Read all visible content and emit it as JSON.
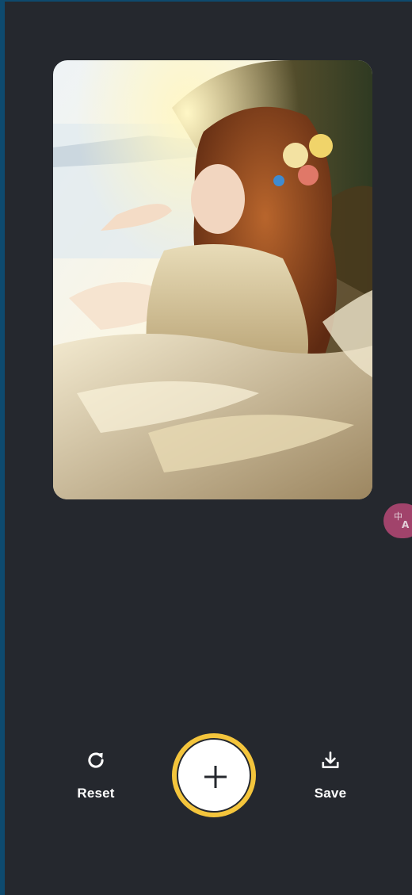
{
  "photo": {
    "alt_name": "portrait-photo"
  },
  "actions": {
    "reset_label": "Reset",
    "save_label": "Save",
    "reset_icon": "refresh-icon",
    "save_icon": "download-icon",
    "add_icon": "plus-icon"
  },
  "translate": {
    "icon": "translate-icon"
  },
  "colors": {
    "background": "#25282e",
    "frame": "#0e4a6e",
    "accent": "#f4c53c",
    "translate_bubble": "#a8456f"
  }
}
